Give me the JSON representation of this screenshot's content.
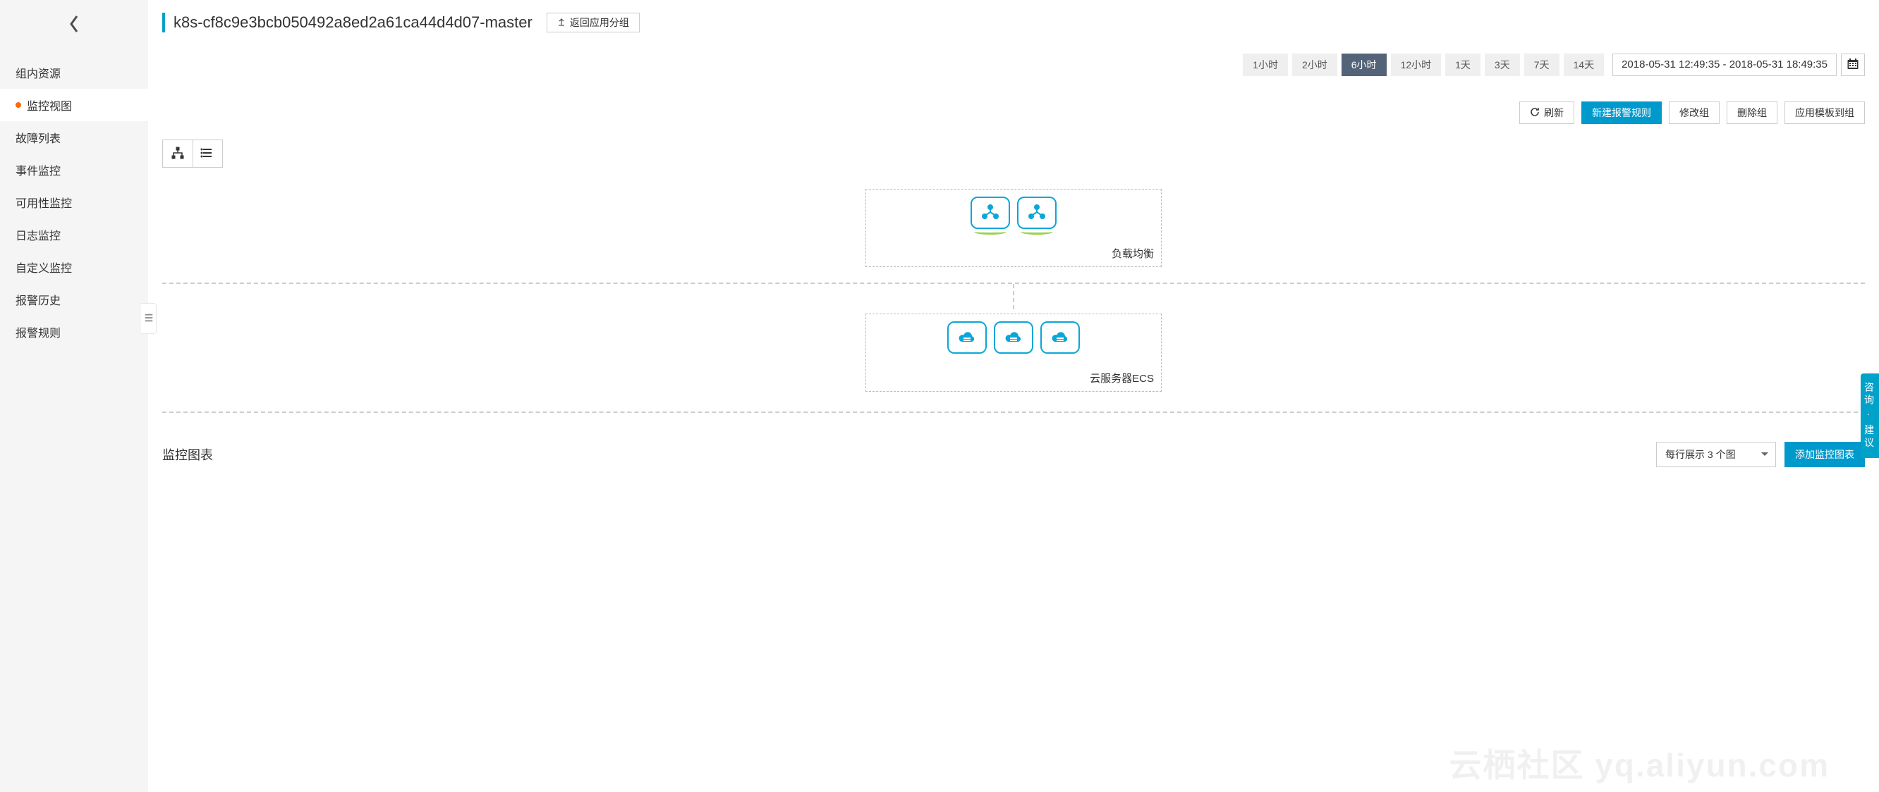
{
  "sidebar": {
    "items": [
      {
        "label": "组内资源"
      },
      {
        "label": "监控视图"
      },
      {
        "label": "故障列表"
      },
      {
        "label": "事件监控"
      },
      {
        "label": "可用性监控"
      },
      {
        "label": "日志监控"
      },
      {
        "label": "自定义监控"
      },
      {
        "label": "报警历史"
      },
      {
        "label": "报警规则"
      }
    ],
    "active_index": 1
  },
  "header": {
    "title": "k8s-cf8c9e3bcb050492a8ed2a61ca44d4d07-master",
    "back_button": "返回应用分组"
  },
  "time": {
    "segments": [
      "1小时",
      "2小时",
      "6小时",
      "12小时",
      "1天",
      "3天",
      "7天",
      "14天"
    ],
    "active_index": 2,
    "range": "2018-05-31 12:49:35 - 2018-05-31 18:49:35"
  },
  "actions": {
    "refresh": "刷新",
    "new_alert_rule": "新建报警规则",
    "modify_group": "修改组",
    "delete_group": "删除组",
    "apply_template": "应用模板到组"
  },
  "topology": {
    "box1_label": "负载均衡",
    "box2_label": "云服务器ECS"
  },
  "chart_section": {
    "title": "监控图表",
    "per_row_label": "每行展示 3 个图",
    "add_chart": "添加监控图表"
  },
  "help_tab": "咨询 · 建议",
  "watermark": "云栖社区 yq.aliyun.com"
}
